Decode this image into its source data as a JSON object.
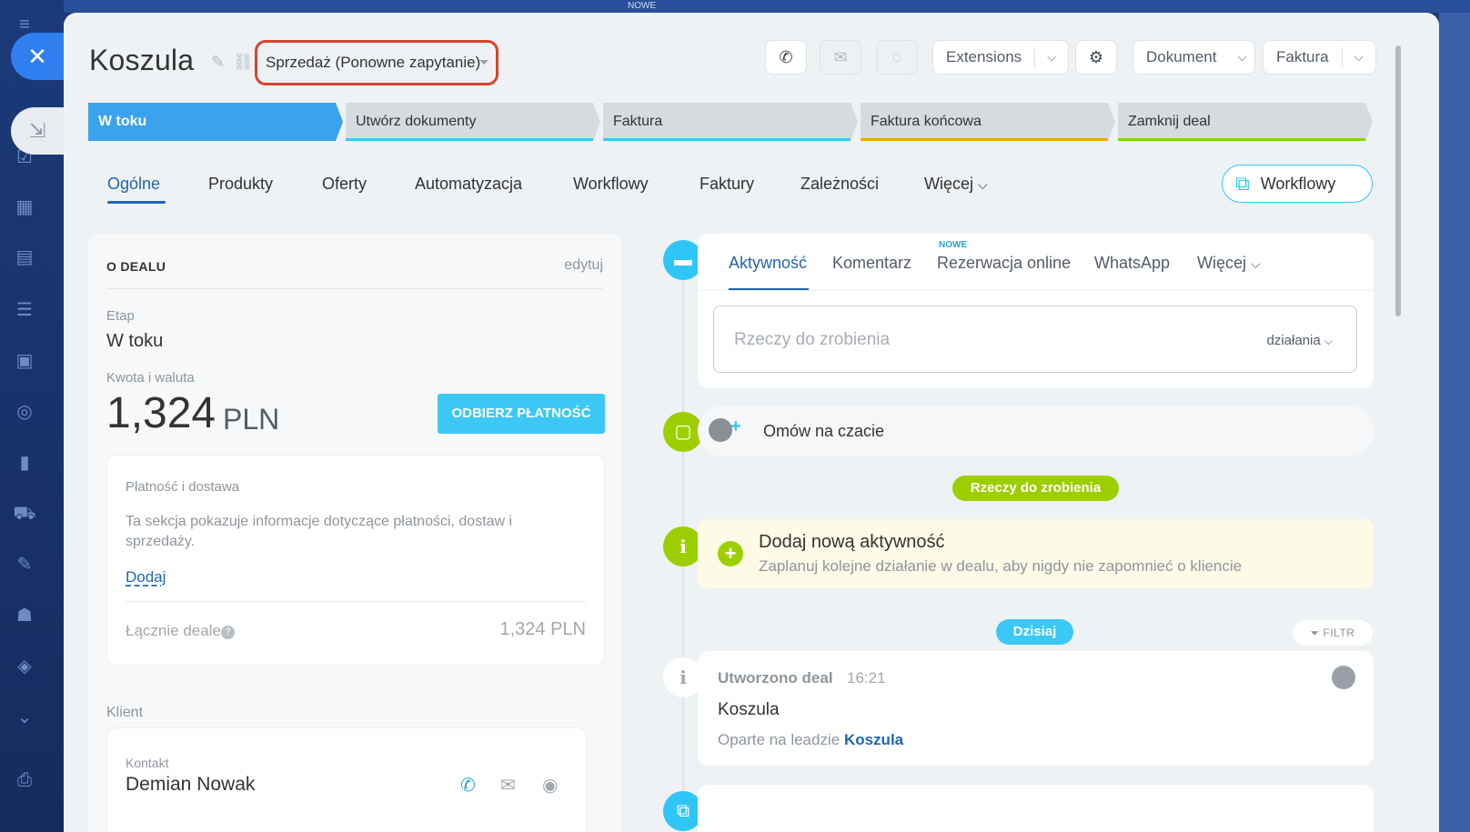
{
  "top_badge": "NOWE",
  "header": {
    "title": "Koszula",
    "pipeline": "Sprzedaż (Ponowne zapytanie)",
    "extensions": "Extensions",
    "document": "Dokument",
    "invoice": "Faktura"
  },
  "stages": [
    {
      "label": "W toku",
      "color": "#3ba2ed",
      "active": true
    },
    {
      "label": "Utwórz dokumenty",
      "color": "#3bc8f5"
    },
    {
      "label": "Faktura",
      "color": "#3bc8f5"
    },
    {
      "label": "Faktura końcowa",
      "color": "#f7a700"
    },
    {
      "label": "Zamknij deal",
      "color": "#7bd500"
    }
  ],
  "tabs": [
    "Ogólne",
    "Produkty",
    "Oferty",
    "Automatyzacja",
    "Workflowy",
    "Faktury",
    "Zależności",
    "Więcej"
  ],
  "workflow_button": "Workflowy",
  "deal": {
    "section_title": "O DEALU",
    "edit": "edytuj",
    "stage_label": "Etap",
    "stage_value": "W toku",
    "amount_label": "Kwota i waluta",
    "amount": "1,324",
    "currency": "PLN",
    "pay_button": "ODBIERZ PŁATNOŚĆ",
    "payment": {
      "title": "Płatność i dostawa",
      "description": "Ta sekcja pokazuje informacje dotyczące płatności, dostaw i sprzedaży.",
      "add": "Dodaj",
      "total_label": "Łącznie deale",
      "total_value": "1,324 PLN"
    },
    "client_label": "Klient",
    "contact_label": "Kontakt",
    "contact_name": "Demian Nowak"
  },
  "activity": {
    "tabs": [
      "Aktywność",
      "Komentarz",
      "Rezerwacja online",
      "WhatsApp",
      "Więcej"
    ],
    "new_badge": "NOWE",
    "todo_placeholder": "Rzeczy do zrobienia",
    "actions": "działania",
    "chat": "Omów na czacie",
    "todo_pill": "Rzeczy do zrobienia",
    "add_title": "Dodaj nową aktywność",
    "add_desc": "Zaplanuj kolejne działanie w dealu, aby nigdy nie zapomnieć o kliencie",
    "today": "Dzisiaj",
    "filter": "FILTR",
    "created": {
      "title": "Utworzono deal",
      "time": "16:21",
      "name": "Koszula",
      "source_prefix": "Oparte na leadzie",
      "source_link": "Koszula"
    }
  }
}
